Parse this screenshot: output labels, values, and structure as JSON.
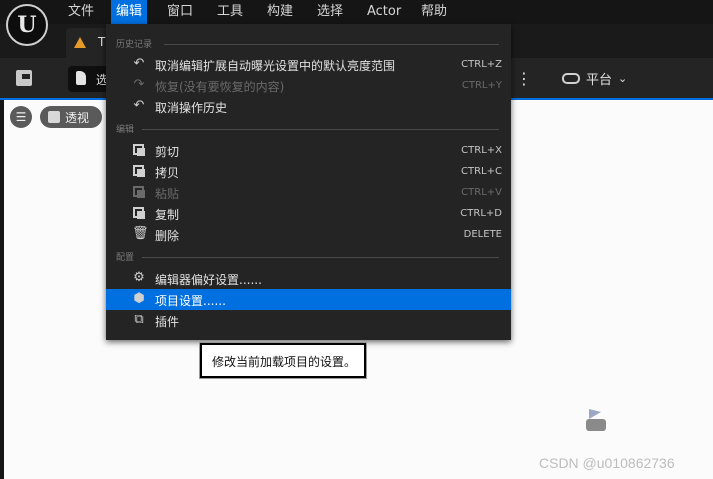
{
  "menubar": {
    "logo": "U",
    "items": [
      {
        "label": "文件"
      },
      {
        "label": "编辑"
      },
      {
        "label": "窗口"
      },
      {
        "label": "工具"
      },
      {
        "label": "构建"
      },
      {
        "label": "选择"
      },
      {
        "label": "Actor"
      },
      {
        "label": "帮助"
      }
    ],
    "active_index": 1
  },
  "tab": {
    "label": "T"
  },
  "toolbar": {
    "select_label": "选",
    "more_label": "⋮",
    "platform_label": "平台"
  },
  "viewport": {
    "menu_icon": "☰",
    "perspective_label": "透视",
    "watermark": "CSDN @u010862736"
  },
  "edit_menu": {
    "sections": [
      {
        "label": "历史记录"
      },
      {
        "label": "编辑"
      },
      {
        "label": "配置"
      }
    ],
    "items": [
      {
        "label": "取消编辑扩展自动曝光设置中的默认亮度范围",
        "shortcut": "CTRL+Z",
        "icon": "undo-icon",
        "glyph": "↶",
        "enabled": true
      },
      {
        "label": "恢复(没有要恢复的内容)",
        "shortcut": "CTRL+Y",
        "icon": "redo-icon",
        "glyph": "↷",
        "enabled": false
      },
      {
        "label": "取消操作历史",
        "shortcut": "",
        "icon": "undo-history-icon",
        "glyph": "↶",
        "enabled": true
      },
      {
        "label": "剪切",
        "shortcut": "CTRL+X",
        "icon": "cut-icon",
        "enabled": true
      },
      {
        "label": "拷贝",
        "shortcut": "CTRL+C",
        "icon": "copy-icon",
        "enabled": true
      },
      {
        "label": "粘贴",
        "shortcut": "CTRL+V",
        "icon": "paste-icon",
        "enabled": false
      },
      {
        "label": "复制",
        "shortcut": "CTRL+D",
        "icon": "duplicate-icon",
        "enabled": true
      },
      {
        "label": "删除",
        "shortcut": "DELETE",
        "icon": "trash-icon",
        "glyph": "🗑",
        "enabled": true
      },
      {
        "label": "编辑器偏好设置......",
        "shortcut": "",
        "icon": "sliders-icon",
        "glyph": "⚙",
        "enabled": true
      },
      {
        "label": "项目设置......",
        "shortcut": "",
        "icon": "project-settings-icon",
        "glyph": "⬢",
        "enabled": true,
        "highlighted": true
      },
      {
        "label": "插件",
        "shortcut": "",
        "icon": "plugin-icon",
        "glyph": "⧉",
        "enabled": true
      }
    ]
  },
  "tooltip": {
    "text": "修改当前加载项目的设置。"
  },
  "colors": {
    "accent": "#0070e0",
    "menu_bg": "#242424",
    "menubar_bg": "#151515",
    "tab_icon": "#e69a2a"
  }
}
